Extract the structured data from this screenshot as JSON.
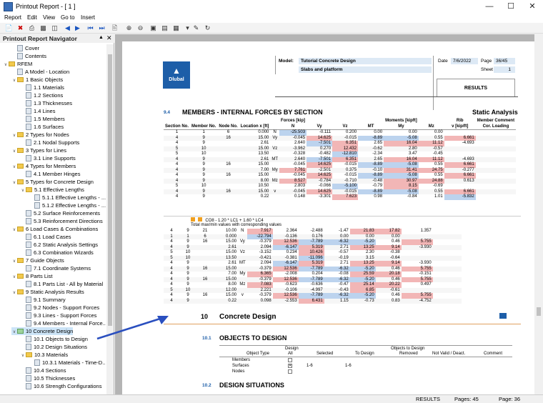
{
  "window": {
    "title": "Printout Report - [ 1 ]"
  },
  "menu": [
    "Report",
    "Edit",
    "View",
    "Go to",
    "Insert"
  ],
  "navigator": {
    "title": "Printout Report Navigator",
    "items": [
      {
        "label": "Cover",
        "level": 1,
        "icon": "page-icon"
      },
      {
        "label": "Contents",
        "level": 1,
        "icon": "page-icon"
      },
      {
        "label": "RFEM",
        "level": 0,
        "icon": "folder-icon"
      },
      {
        "label": "A Model - Location",
        "level": 1,
        "icon": "page-icon"
      },
      {
        "label": "1 Basic Objects",
        "level": 1,
        "icon": "folder-icon"
      },
      {
        "label": "1.1 Materials",
        "level": 2,
        "icon": "page-icon"
      },
      {
        "label": "1.2 Sections",
        "level": 2,
        "icon": "page-icon"
      },
      {
        "label": "1.3 Thicknesses",
        "level": 2,
        "icon": "page-icon"
      },
      {
        "label": "1.4 Lines",
        "level": 2,
        "icon": "page-icon"
      },
      {
        "label": "1.5 Members",
        "level": 2,
        "icon": "page-icon"
      },
      {
        "label": "1.6 Surfaces",
        "level": 2,
        "icon": "page-icon"
      },
      {
        "label": "2 Types for Nodes",
        "level": 1,
        "icon": "folder-icon"
      },
      {
        "label": "2.1 Nodal Supports",
        "level": 2,
        "icon": "page-icon"
      },
      {
        "label": "3 Types for Lines",
        "level": 1,
        "icon": "folder-icon"
      },
      {
        "label": "3.1 Line Supports",
        "level": 2,
        "icon": "page-icon"
      },
      {
        "label": "4 Types for Members",
        "level": 1,
        "icon": "folder-icon"
      },
      {
        "label": "4.1 Member Hinges",
        "level": 2,
        "icon": "page-icon"
      },
      {
        "label": "5 Types for Concrete Design",
        "level": 1,
        "icon": "folder-icon"
      },
      {
        "label": "5.1 Effective Lengths",
        "level": 2,
        "icon": "folder-icon"
      },
      {
        "label": "5.1.1 Effective Lengths - ...",
        "level": 3,
        "icon": "page-icon"
      },
      {
        "label": "5.1.2 Effective Lengths - ...",
        "level": 3,
        "icon": "page-icon"
      },
      {
        "label": "5.2 Surface Reinforcements",
        "level": 2,
        "icon": "page-icon"
      },
      {
        "label": "5.3 Reinforcement Directions",
        "level": 2,
        "icon": "page-icon"
      },
      {
        "label": "6 Load Cases & Combinations",
        "level": 1,
        "icon": "folder-icon"
      },
      {
        "label": "6.1 Load Cases",
        "level": 2,
        "icon": "page-icon"
      },
      {
        "label": "6.2 Static Analysis Settings",
        "level": 2,
        "icon": "page-icon"
      },
      {
        "label": "6.3 Combination Wizards",
        "level": 2,
        "icon": "page-icon"
      },
      {
        "label": "7 Guide Objects",
        "level": 1,
        "icon": "folder-icon"
      },
      {
        "label": "7.1 Coordinate Systems",
        "level": 2,
        "icon": "page-icon"
      },
      {
        "label": "8 Parts List",
        "level": 1,
        "icon": "folder-icon"
      },
      {
        "label": "8.1 Parts List - All by Material",
        "level": 2,
        "icon": "page-icon"
      },
      {
        "label": "9 Static Analysis Results",
        "level": 1,
        "icon": "folder-icon"
      },
      {
        "label": "9.1 Summary",
        "level": 2,
        "icon": "page-icon"
      },
      {
        "label": "9.2 Nodes - Support Forces",
        "level": 2,
        "icon": "page-icon"
      },
      {
        "label": "9.3 Lines - Support Forces",
        "level": 2,
        "icon": "page-icon"
      },
      {
        "label": "9.4 Members - Internal Force...",
        "level": 2,
        "icon": "page-icon"
      },
      {
        "label": "10 Concrete Design",
        "level": 1,
        "icon": "folder-icon",
        "selected": true
      },
      {
        "label": "10.1 Objects to Design",
        "level": 2,
        "icon": "page-icon"
      },
      {
        "label": "10.2 Design Situations",
        "level": 2,
        "icon": "page-icon"
      },
      {
        "label": "10.3 Materials",
        "level": 2,
        "icon": "folder-icon"
      },
      {
        "label": "10.3.1 Materials - Time-D...",
        "level": 3,
        "icon": "page-icon"
      },
      {
        "label": "10.4 Sections",
        "level": 2,
        "icon": "page-icon"
      },
      {
        "label": "10.5 Thicknesses",
        "level": 2,
        "icon": "page-icon"
      },
      {
        "label": "10.6 Strength Configurations",
        "level": 2,
        "icon": "page-icon"
      }
    ]
  },
  "report": {
    "model_label": "Model:",
    "model": "Tutorial Concrete Design",
    "model2": "Slabs and platform",
    "date_label": "Date",
    "date": "7/6/2022",
    "page_label": "Page",
    "page": "36/45",
    "sheet_label": "Sheet",
    "sheet": "1",
    "results_label": "RESULTS",
    "logo_text": "Dlubal",
    "section_num": "9.4",
    "section_title": "MEMBERS - INTERNAL FORCES BY SECTION",
    "section_right": "Static Analysis",
    "col_headers": [
      "Section No.",
      "Member No.",
      "Node No.",
      "Location x [ft]",
      "",
      "N",
      "Vy",
      "Vz",
      "MT",
      "My",
      "Mz",
      "v [kip/ft]",
      "Cor. Loading"
    ],
    "group_headers": {
      "forces": "Forces [kip]",
      "moments": "Moments [kipft]",
      "rib": "Rib",
      "comment": "Member Comment"
    },
    "rows1": [
      [
        "1",
        "1",
        "6",
        "0.000",
        "N",
        "-25.503",
        "-0.111",
        "0.200",
        "0.00",
        "0.00",
        "0.00",
        ""
      ],
      [
        "4",
        "9",
        "16",
        "15.00",
        "Vy",
        "-0.045",
        "14.625",
        "-0.015",
        "-8.89",
        "-5.08",
        "0.55",
        "6.661"
      ],
      [
        "4",
        "9",
        "",
        "2.61",
        "",
        "2.640",
        "-7.501",
        "6.351",
        "2.65",
        "16.04",
        "11.12",
        "-4.693"
      ],
      [
        "5",
        "10",
        "",
        "15.00",
        "Vz",
        "-3.962",
        "0.270",
        "12.432",
        "-0.62",
        "2.80",
        "-0.57",
        ""
      ],
      [
        "5",
        "10",
        "",
        "13.50",
        "",
        "-0.328",
        "-0.482",
        "-12.810",
        "-2.34",
        "3.47",
        "-0.45",
        ""
      ],
      [
        "4",
        "9",
        "",
        "2.61",
        "MT",
        "2.640",
        "-7.501",
        "6.351",
        "2.65",
        "16.04",
        "11.12",
        "-4.693"
      ],
      [
        "4",
        "9",
        "16",
        "15.00",
        "",
        "-0.045",
        "14.625",
        "-0.015",
        "-8.89",
        "-5.08",
        "0.55",
        "6.661"
      ],
      [
        "4",
        "9",
        "",
        "7.00",
        "My",
        "7.761",
        "-2.501",
        "0.375",
        "-0.10",
        "31.41",
        "24.75",
        "-0.277"
      ],
      [
        "4",
        "9",
        "16",
        "15.00",
        "",
        "-0.045",
        "14.625",
        "-0.015",
        "-8.89",
        "-5.08",
        "0.55",
        "6.661"
      ],
      [
        "4",
        "9",
        "",
        "8.00",
        "Mz",
        "8.527",
        "-0.784",
        "-0.710",
        "-0.48",
        "30.97",
        "24.88",
        "0.613"
      ],
      [
        "5",
        "10",
        "",
        "10.50",
        "",
        "2.803",
        "-0.066",
        "-5.100",
        "-0.79",
        "8.15",
        "-0.69",
        ""
      ],
      [
        "4",
        "9",
        "16",
        "15.00",
        "v",
        "-0.045",
        "14.625",
        "-0.015",
        "-8.89",
        "-5.08",
        "0.55",
        "6.661"
      ],
      [
        "4",
        "9",
        "",
        "0.22",
        "",
        "0.148",
        "-3.301",
        "7.623",
        "0.98",
        "-0.84",
        "1.01",
        "-5.832"
      ]
    ],
    "combo_label": "CO8 - 1.20 * LC1 + 1.60 * LC4",
    "combo_note": "Total max/min values with corresponding values",
    "rows2": [
      [
        "4",
        "9",
        "21",
        "10.00",
        "N",
        "7.917",
        "2.364",
        "-2.488",
        "-1.47",
        "21.83",
        "17.82",
        "1.357"
      ],
      [
        "1",
        "1",
        "6",
        "0.000",
        "",
        "-22.794",
        "-0.136",
        "0.176",
        "0.00",
        "0.00",
        "0.00",
        ""
      ],
      [
        "4",
        "9",
        "16",
        "15.00",
        "Vy",
        "-0.379",
        "12.536",
        "-7.789",
        "-6.32",
        "-5.20",
        "0.46",
        "5.755"
      ],
      [
        "4",
        "9",
        "",
        "2.61",
        "",
        "2.094",
        "-6.147",
        "5.319",
        "2.71",
        "13.25",
        "9.14",
        "-3.930"
      ],
      [
        "5",
        "10",
        "",
        "15.00",
        "Vz",
        "-3.152",
        "0.234",
        "10.426",
        "-0.57",
        "2.30",
        "-0.38",
        ""
      ],
      [
        "5",
        "10",
        "",
        "13.50",
        "",
        "-0.421",
        "-0.381",
        "-11.096",
        "-0.19",
        "3.15",
        "-0.64",
        ""
      ],
      [
        "4",
        "9",
        "",
        "2.61",
        "MT",
        "2.094",
        "-6.147",
        "5.319",
        "2.71",
        "13.25",
        "9.14",
        "-3.930"
      ],
      [
        "4",
        "9",
        "16",
        "15.00",
        "",
        "-0.379",
        "12.536",
        "-7.789",
        "-6.32",
        "-5.20",
        "0.46",
        "5.755"
      ],
      [
        "4",
        "9",
        "",
        "7.00",
        "My",
        "6.365",
        "-2.008",
        "0.204",
        "-0.08",
        "25.59",
        "20.18",
        "-0.151"
      ],
      [
        "4",
        "9",
        "16",
        "15.00",
        "",
        "-0.379",
        "12.536",
        "-7.789",
        "-6.32",
        "-5.20",
        "0.46",
        "5.755"
      ],
      [
        "4",
        "9",
        "",
        "8.00",
        "Mz",
        "7.083",
        "-0.623",
        "-0.636",
        "-0.47",
        "25.14",
        "20.22",
        "0.497"
      ],
      [
        "5",
        "10",
        "",
        "12.00",
        "",
        "2.221",
        "-0.106",
        "-4.997",
        "-0.43",
        "6.85",
        "-0.61",
        ""
      ],
      [
        "4",
        "9",
        "16",
        "15.00",
        "v",
        "-0.379",
        "12.536",
        "-7.789",
        "-6.32",
        "-5.20",
        "0.46",
        "5.755"
      ],
      [
        "4",
        "9",
        "",
        "0.22",
        "",
        "0.098",
        "-2.553",
        "6.431",
        "1.15",
        "-0.73",
        "0.83",
        "-4.752"
      ]
    ],
    "ch10_num": "10",
    "ch10_title": "Concrete Design",
    "s101_num": "10.1",
    "s101_title": "OBJECTS TO DESIGN",
    "otd_headers": [
      "Object Type",
      "Design All",
      "Selected",
      "To Design",
      "Removed",
      "Not Valid / Deact.",
      "Comment"
    ],
    "otd_group": "Objects to Design",
    "otd_design": "Design",
    "otd_all": "All",
    "otd_rows": [
      {
        "type": "Members",
        "checked": false,
        "selected": "",
        "todesign": ""
      },
      {
        "type": "Surfaces",
        "checked": true,
        "selected": "1-6",
        "todesign": "1-6"
      },
      {
        "type": "Nodes",
        "checked": false,
        "selected": "",
        "todesign": ""
      }
    ],
    "s102_num": "10.2",
    "s102_title": "DESIGN SITUATIONS"
  },
  "status": {
    "left": "RESULTS",
    "pages": "Pages: 45",
    "page": "Page: 36"
  }
}
